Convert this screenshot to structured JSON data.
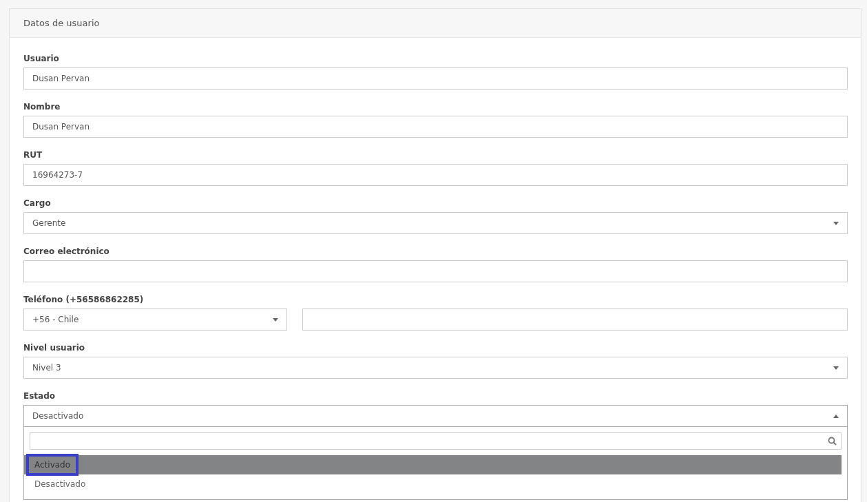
{
  "panel": {
    "title": "Datos de usuario"
  },
  "fields": [
    {
      "kind": "text",
      "label": "Usuario",
      "value": "Dusan Pervan"
    },
    {
      "kind": "text",
      "label": "Nombre",
      "value": "Dusan Pervan"
    },
    {
      "kind": "text",
      "label": "RUT",
      "value": "16964273-7"
    },
    {
      "kind": "select",
      "label": "Cargo",
      "value": "Gerente",
      "expanded": false
    },
    {
      "kind": "text",
      "label": "Correo electrónico"
    },
    {
      "kind": "phone",
      "label": "Teléfono (+56586862285)",
      "country": "+56 - Chile"
    },
    {
      "kind": "select",
      "label": "Nivel usuario",
      "value": "Nivel 3",
      "expanded": false
    },
    {
      "kind": "select",
      "label": "Estado",
      "value": "Desactivado",
      "expanded": true,
      "options": [
        {
          "label": "Activado",
          "highlighted": true,
          "focused": true
        },
        {
          "label": "Desactivado",
          "highlighted": false,
          "focused": false
        }
      ]
    }
  ]
}
